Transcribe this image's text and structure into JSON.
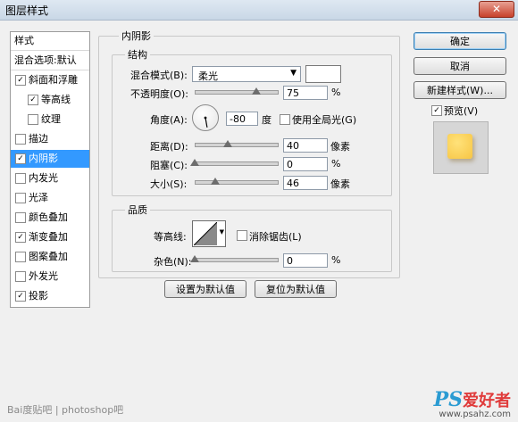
{
  "window": {
    "title": "图层样式",
    "close_glyph": "✕"
  },
  "style_list": [
    {
      "label": "样式",
      "checkbox": false,
      "checked": false,
      "indent": 0,
      "selected": false
    },
    {
      "label": "混合选项:默认",
      "checkbox": false,
      "checked": false,
      "indent": 0,
      "selected": false
    },
    {
      "label": "斜面和浮雕",
      "checkbox": true,
      "checked": true,
      "indent": 0,
      "selected": false
    },
    {
      "label": "等高线",
      "checkbox": true,
      "checked": true,
      "indent": 1,
      "selected": false
    },
    {
      "label": "纹理",
      "checkbox": true,
      "checked": false,
      "indent": 1,
      "selected": false
    },
    {
      "label": "描边",
      "checkbox": true,
      "checked": false,
      "indent": 0,
      "selected": false
    },
    {
      "label": "内阴影",
      "checkbox": true,
      "checked": true,
      "indent": 0,
      "selected": true
    },
    {
      "label": "内发光",
      "checkbox": true,
      "checked": false,
      "indent": 0,
      "selected": false
    },
    {
      "label": "光泽",
      "checkbox": true,
      "checked": false,
      "indent": 0,
      "selected": false
    },
    {
      "label": "颜色叠加",
      "checkbox": true,
      "checked": false,
      "indent": 0,
      "selected": false
    },
    {
      "label": "渐变叠加",
      "checkbox": true,
      "checked": true,
      "indent": 0,
      "selected": false
    },
    {
      "label": "图案叠加",
      "checkbox": true,
      "checked": false,
      "indent": 0,
      "selected": false
    },
    {
      "label": "外发光",
      "checkbox": true,
      "checked": false,
      "indent": 0,
      "selected": false
    },
    {
      "label": "投影",
      "checkbox": true,
      "checked": true,
      "indent": 0,
      "selected": false
    }
  ],
  "panel": {
    "title": "内阴影"
  },
  "structure": {
    "title": "结构",
    "blend_mode_label": "混合模式(B):",
    "blend_mode_value": "柔光",
    "blend_color": "#ffffff",
    "opacity_label": "不透明度(O):",
    "opacity_value": "75",
    "opacity_unit": "%",
    "opacity_fraction": 0.75,
    "angle_label": "角度(A):",
    "angle_value": "-80",
    "angle_unit": "度",
    "global_light_label": "使用全局光(G)",
    "global_light_checked": false,
    "distance_label": "距离(D):",
    "distance_value": "40",
    "distance_unit": "像素",
    "distance_fraction": 0.4,
    "choke_label": "阻塞(C):",
    "choke_value": "0",
    "choke_unit": "%",
    "choke_fraction": 0.0,
    "size_label": "大小(S):",
    "size_value": "46",
    "size_unit": "像素",
    "size_fraction": 0.25
  },
  "quality": {
    "title": "品质",
    "contour_label": "等高线:",
    "antialias_label": "消除锯齿(L)",
    "antialias_checked": false,
    "noise_label": "杂色(N):",
    "noise_value": "0",
    "noise_unit": "%",
    "noise_fraction": 0.0
  },
  "buttons": {
    "make_default": "设置为默认值",
    "reset_default": "复位为默认值",
    "ok": "确定",
    "cancel": "取消",
    "new_style": "新建样式(W)...",
    "preview_label": "预览(V)",
    "preview_checked": true
  },
  "watermark": {
    "left": "Bai度贴吧 | photoshop吧",
    "ps_brand": "PS",
    "ps_name": "爱好者",
    "ps_url": "www.psahz.com"
  },
  "colors": {
    "selection": "#3399ff",
    "preview_fill": "#f7c544"
  }
}
